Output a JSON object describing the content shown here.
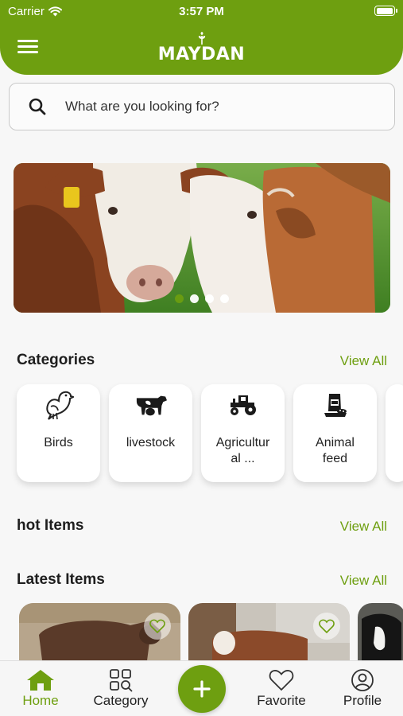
{
  "status_bar": {
    "carrier": "Carrier",
    "time": "3:57 PM",
    "battery_level": 1.0
  },
  "header": {
    "logo_text": "MAYDAN",
    "menu_icon": "hamburger-menu-icon",
    "logo_icon": "wheat-leaf-icon"
  },
  "search": {
    "placeholder": "What are you looking for?",
    "value": "",
    "icon": "search-icon"
  },
  "banner": {
    "slide_count": 4,
    "active_index": 0
  },
  "categories": {
    "title": "Categories",
    "view_all": "View All",
    "items": [
      {
        "label": "Birds",
        "icon": "bird-icon"
      },
      {
        "label": "livestock",
        "icon": "cow-icon"
      },
      {
        "label": "Agricultur al ...",
        "label_line1": "Agricultur",
        "label_line2": "al ...",
        "icon": "tractor-icon"
      },
      {
        "label": "Animal feed",
        "label_line1": "Animal",
        "label_line2": "feed",
        "icon": "feed-bag-icon"
      }
    ]
  },
  "hot_items": {
    "title": "hot Items",
    "view_all": "View All"
  },
  "latest_items": {
    "title": "Latest Items",
    "view_all": "View All",
    "favorite_icon": "heart-outline-icon"
  },
  "bottom_nav": {
    "items": [
      {
        "label": "Home",
        "icon": "home-icon",
        "active": true
      },
      {
        "label": "Category",
        "icon": "category-grid-icon",
        "active": false
      },
      {
        "label": "Favorite",
        "icon": "heart-icon",
        "active": false
      },
      {
        "label": "Profile",
        "icon": "profile-icon",
        "active": false
      }
    ],
    "fab_icon": "plus-icon"
  },
  "colors": {
    "brand": "#6e9f10",
    "background": "#f7f7f7",
    "text": "#1e1e1e"
  }
}
